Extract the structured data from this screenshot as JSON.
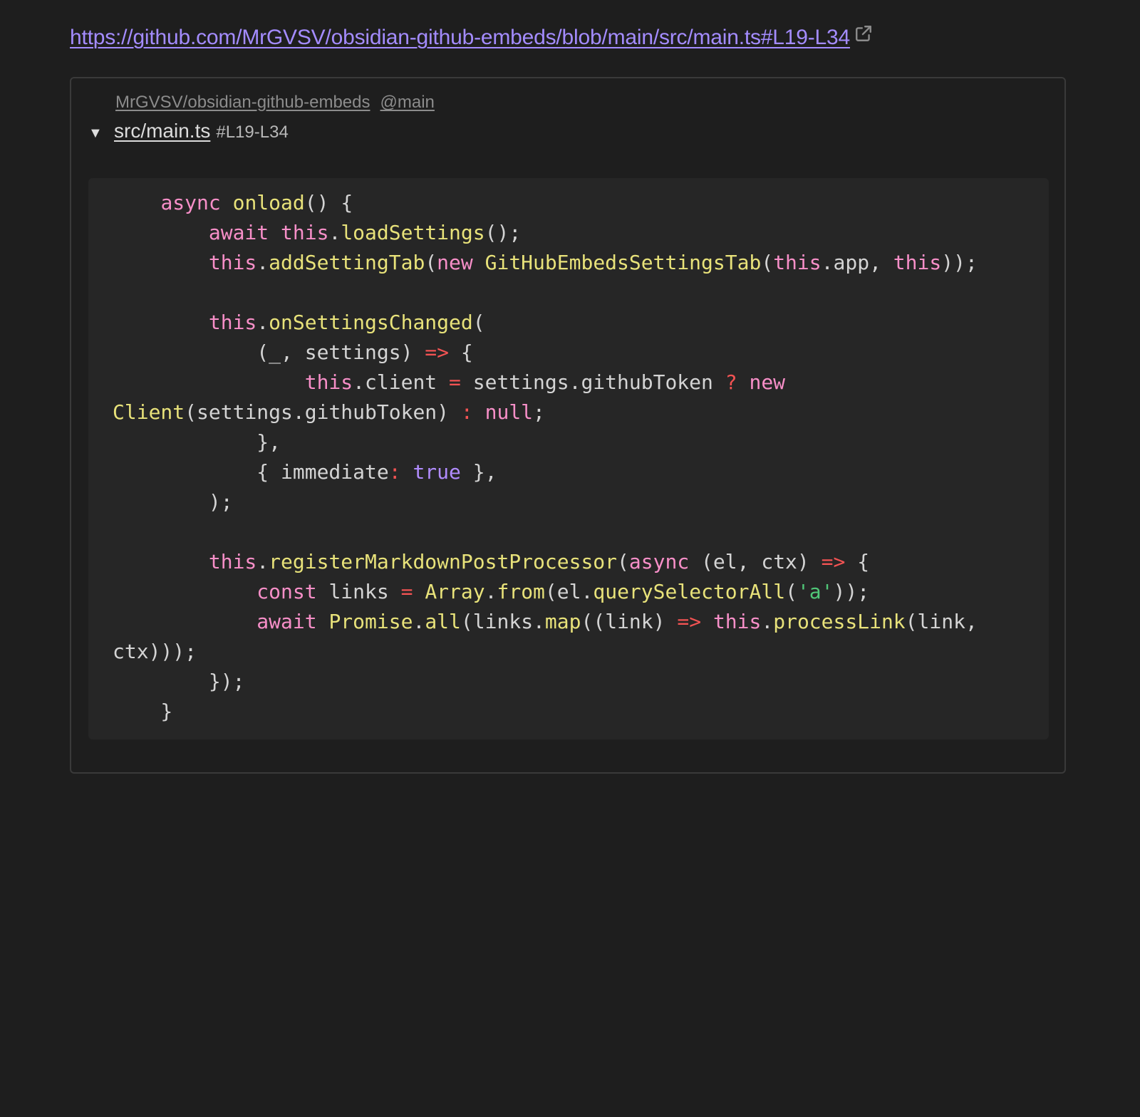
{
  "link": {
    "url": "https://github.com/MrGVSV/obsidian-github-embeds/blob/main/src/main.ts#L19-L34",
    "icon": "external-link-icon",
    "color": "#a48cff"
  },
  "embed": {
    "repo": "MrGVSV/obsidian-github-embeds",
    "branch": "@main",
    "toggle_icon": "▼",
    "file_path": "src/main.ts",
    "line_range": "#L19-L34"
  },
  "code": {
    "language": "typescript",
    "colors": {
      "keyword": "#f78fc8",
      "function": "#e8e27a",
      "operator": "#f25353",
      "boolean": "#b18cff",
      "string": "#50c878",
      "text": "#d4d4d4",
      "background": "#262626"
    },
    "lines": [
      [
        {
          "t": "    "
        },
        {
          "t": "async",
          "c": "kw"
        },
        {
          "t": " "
        },
        {
          "t": "onload",
          "c": "fn"
        },
        {
          "t": "() {"
        }
      ],
      [
        {
          "t": "        "
        },
        {
          "t": "await",
          "c": "kw"
        },
        {
          "t": " "
        },
        {
          "t": "this",
          "c": "kw"
        },
        {
          "t": "."
        },
        {
          "t": "loadSettings",
          "c": "fn"
        },
        {
          "t": "();"
        }
      ],
      [
        {
          "t": "        "
        },
        {
          "t": "this",
          "c": "kw"
        },
        {
          "t": "."
        },
        {
          "t": "addSettingTab",
          "c": "fn"
        },
        {
          "t": "("
        },
        {
          "t": "new",
          "c": "kw"
        },
        {
          "t": " "
        },
        {
          "t": "GitHubEmbedsSettingsTab",
          "c": "fn"
        },
        {
          "t": "("
        },
        {
          "t": "this",
          "c": "kw"
        },
        {
          "t": ".app, "
        },
        {
          "t": "this",
          "c": "kw"
        },
        {
          "t": "));"
        }
      ],
      [],
      [
        {
          "t": "        "
        },
        {
          "t": "this",
          "c": "kw"
        },
        {
          "t": "."
        },
        {
          "t": "onSettingsChanged",
          "c": "fn"
        },
        {
          "t": "("
        }
      ],
      [
        {
          "t": "            (_, settings) "
        },
        {
          "t": "=>",
          "c": "op"
        },
        {
          "t": " {"
        }
      ],
      [
        {
          "t": "                "
        },
        {
          "t": "this",
          "c": "kw"
        },
        {
          "t": ".client "
        },
        {
          "t": "=",
          "c": "op"
        },
        {
          "t": " settings.githubToken "
        },
        {
          "t": "?",
          "c": "op"
        },
        {
          "t": " "
        },
        {
          "t": "new",
          "c": "kw"
        }
      ],
      [
        {
          "t": "Client",
          "c": "fn"
        },
        {
          "t": "(settings.githubToken) "
        },
        {
          "t": ":",
          "c": "op"
        },
        {
          "t": " "
        },
        {
          "t": "null",
          "c": "kw"
        },
        {
          "t": ";"
        }
      ],
      [
        {
          "t": "            },"
        }
      ],
      [
        {
          "t": "            { immediate"
        },
        {
          "t": ":",
          "c": "op"
        },
        {
          "t": " "
        },
        {
          "t": "true",
          "c": "bool"
        },
        {
          "t": " },"
        }
      ],
      [
        {
          "t": "        );"
        }
      ],
      [],
      [
        {
          "t": "        "
        },
        {
          "t": "this",
          "c": "kw"
        },
        {
          "t": "."
        },
        {
          "t": "registerMarkdownPostProcessor",
          "c": "fn"
        },
        {
          "t": "("
        },
        {
          "t": "async",
          "c": "kw"
        },
        {
          "t": " (el, ctx) "
        },
        {
          "t": "=>",
          "c": "op"
        },
        {
          "t": " {"
        }
      ],
      [
        {
          "t": "            "
        },
        {
          "t": "const",
          "c": "kw"
        },
        {
          "t": " links "
        },
        {
          "t": "=",
          "c": "op"
        },
        {
          "t": " "
        },
        {
          "t": "Array",
          "c": "fn"
        },
        {
          "t": "."
        },
        {
          "t": "from",
          "c": "fn"
        },
        {
          "t": "(el."
        },
        {
          "t": "querySelectorAll",
          "c": "fn"
        },
        {
          "t": "("
        },
        {
          "t": "'a'",
          "c": "str"
        },
        {
          "t": "));"
        }
      ],
      [
        {
          "t": "            "
        },
        {
          "t": "await",
          "c": "kw"
        },
        {
          "t": " "
        },
        {
          "t": "Promise",
          "c": "fn"
        },
        {
          "t": "."
        },
        {
          "t": "all",
          "c": "fn"
        },
        {
          "t": "(links."
        },
        {
          "t": "map",
          "c": "fn"
        },
        {
          "t": "((link) "
        },
        {
          "t": "=>",
          "c": "op"
        },
        {
          "t": " "
        },
        {
          "t": "this",
          "c": "kw"
        },
        {
          "t": "."
        },
        {
          "t": "processLink",
          "c": "fn"
        },
        {
          "t": "(link,"
        }
      ],
      [
        {
          "t": "ctx)));"
        }
      ],
      [
        {
          "t": "        });"
        }
      ],
      [
        {
          "t": "    }"
        }
      ]
    ]
  }
}
